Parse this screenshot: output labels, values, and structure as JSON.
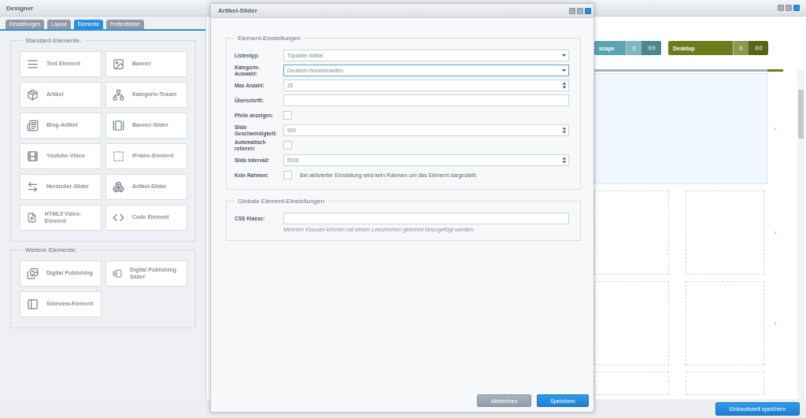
{
  "window": {
    "title": "Designer"
  },
  "tabs": [
    {
      "label": "Einstellungen",
      "selected": false
    },
    {
      "label": "Layout",
      "selected": false
    },
    {
      "label": "Elemente",
      "selected": true
    },
    {
      "label": "Freitextfelder",
      "selected": false
    }
  ],
  "groups": [
    {
      "title": "Standard-Elemente:",
      "items": [
        "Text Element",
        "Banner",
        "Artikel",
        "Kategorie-Teaser",
        "Blog-Artikel",
        "Banner-Slider",
        "Youtube-Video",
        "iFrame-Element",
        "Hersteller-Slider",
        "Artikel-Slider",
        "HTML5 Video-Element",
        "Code Element"
      ]
    },
    {
      "title": "Weitere Elemente:",
      "items": [
        "Digital Publishing",
        "Digital Publishing Slider",
        "Sideview-Element"
      ]
    }
  ],
  "canvas": {
    "devices": [
      {
        "label": "scape",
        "count": "0",
        "color": "#5ca4b1"
      },
      {
        "label": "Desktop",
        "count": "0",
        "color": "#6b7c1d"
      }
    ],
    "row_marks": [
      "x",
      "x",
      "x"
    ]
  },
  "save_button": "Einkaufswelt speichern",
  "dialog": {
    "title": "Artikel-Slider",
    "sections": [
      {
        "title": "Element-Einstellungen",
        "fields": [
          {
            "kind": "select",
            "label": "Listentyp:",
            "value": "Topseller Artikel",
            "focused": false
          },
          {
            "kind": "select",
            "label": "Kategorie-Auswahl:",
            "value": "Deutsch>Sommerwelten",
            "focused": true
          },
          {
            "kind": "number",
            "label": "Max Anzahl:",
            "value": "25",
            "focused": false
          },
          {
            "kind": "text",
            "label": "Überschrift:",
            "focused": false
          },
          {
            "kind": "checkbox",
            "label": "Pfeile anzeigen:",
            "checked": false
          },
          {
            "kind": "number",
            "label": "Slide Geschwindigkeit:",
            "value": "500",
            "focused": false
          },
          {
            "kind": "checkbox",
            "label": "Automatisch rotieren:",
            "checked": false
          },
          {
            "kind": "number",
            "label": "Slide Intervall:",
            "value": "5000",
            "focused": false
          },
          {
            "kind": "checkbox",
            "label": "Kein Rahmen:",
            "checked": false,
            "note": "Bei aktivierter Einstellung wird kein Rahmen um das Element dargestellt."
          }
        ]
      },
      {
        "title": "Globale Element-Einstellungen",
        "fields": [
          {
            "kind": "text",
            "label": "CSS Klasse:",
            "focused": false,
            "hint": "Mehrere Klassen können mit einem Leerzeichen getrennt hinzugefügt werden."
          }
        ]
      }
    ],
    "buttons": [
      {
        "kind": "cancel",
        "label": "Abbrechen"
      },
      {
        "kind": "primary",
        "label": "Speichern"
      }
    ]
  }
}
